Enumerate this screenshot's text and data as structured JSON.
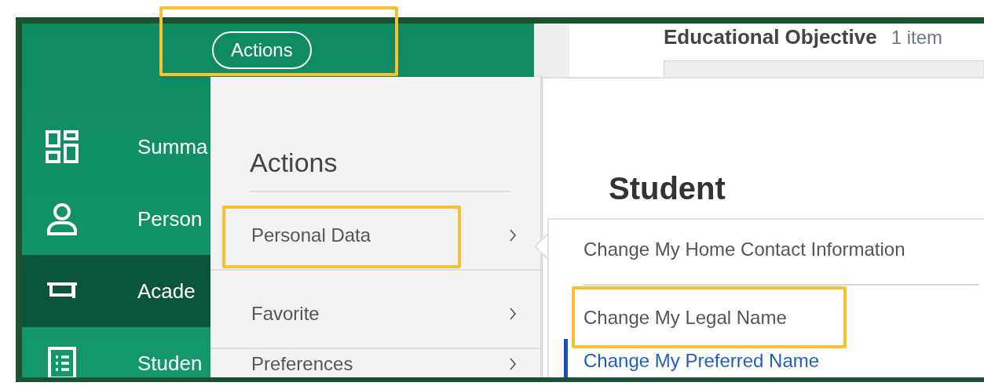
{
  "header": {
    "actions_button": {
      "label": "Actions",
      "highlighted": true
    }
  },
  "sidebar": {
    "items": [
      {
        "label": "Summa",
        "selected": false
      },
      {
        "label": "Person",
        "selected": false
      },
      {
        "label": "Acade",
        "selected": true
      },
      {
        "label": "Studen",
        "selected": false
      }
    ]
  },
  "section": {
    "title": "Educational Objective",
    "count": "1 item"
  },
  "page_title": "Student",
  "actions_menu": {
    "title": "Actions",
    "items": [
      {
        "label": "Personal Data",
        "highlighted": true
      },
      {
        "label": "Favorite",
        "highlighted": false
      },
      {
        "label": "Preferences",
        "highlighted": false
      }
    ]
  },
  "submenu": {
    "items": [
      {
        "label": "Change My Home Contact Information",
        "highlighted": false,
        "selected": false
      },
      {
        "label": "Change My Legal Name",
        "highlighted": true,
        "selected": false
      },
      {
        "label": "Change My Preferred Name",
        "highlighted": false,
        "selected": true
      }
    ]
  }
}
